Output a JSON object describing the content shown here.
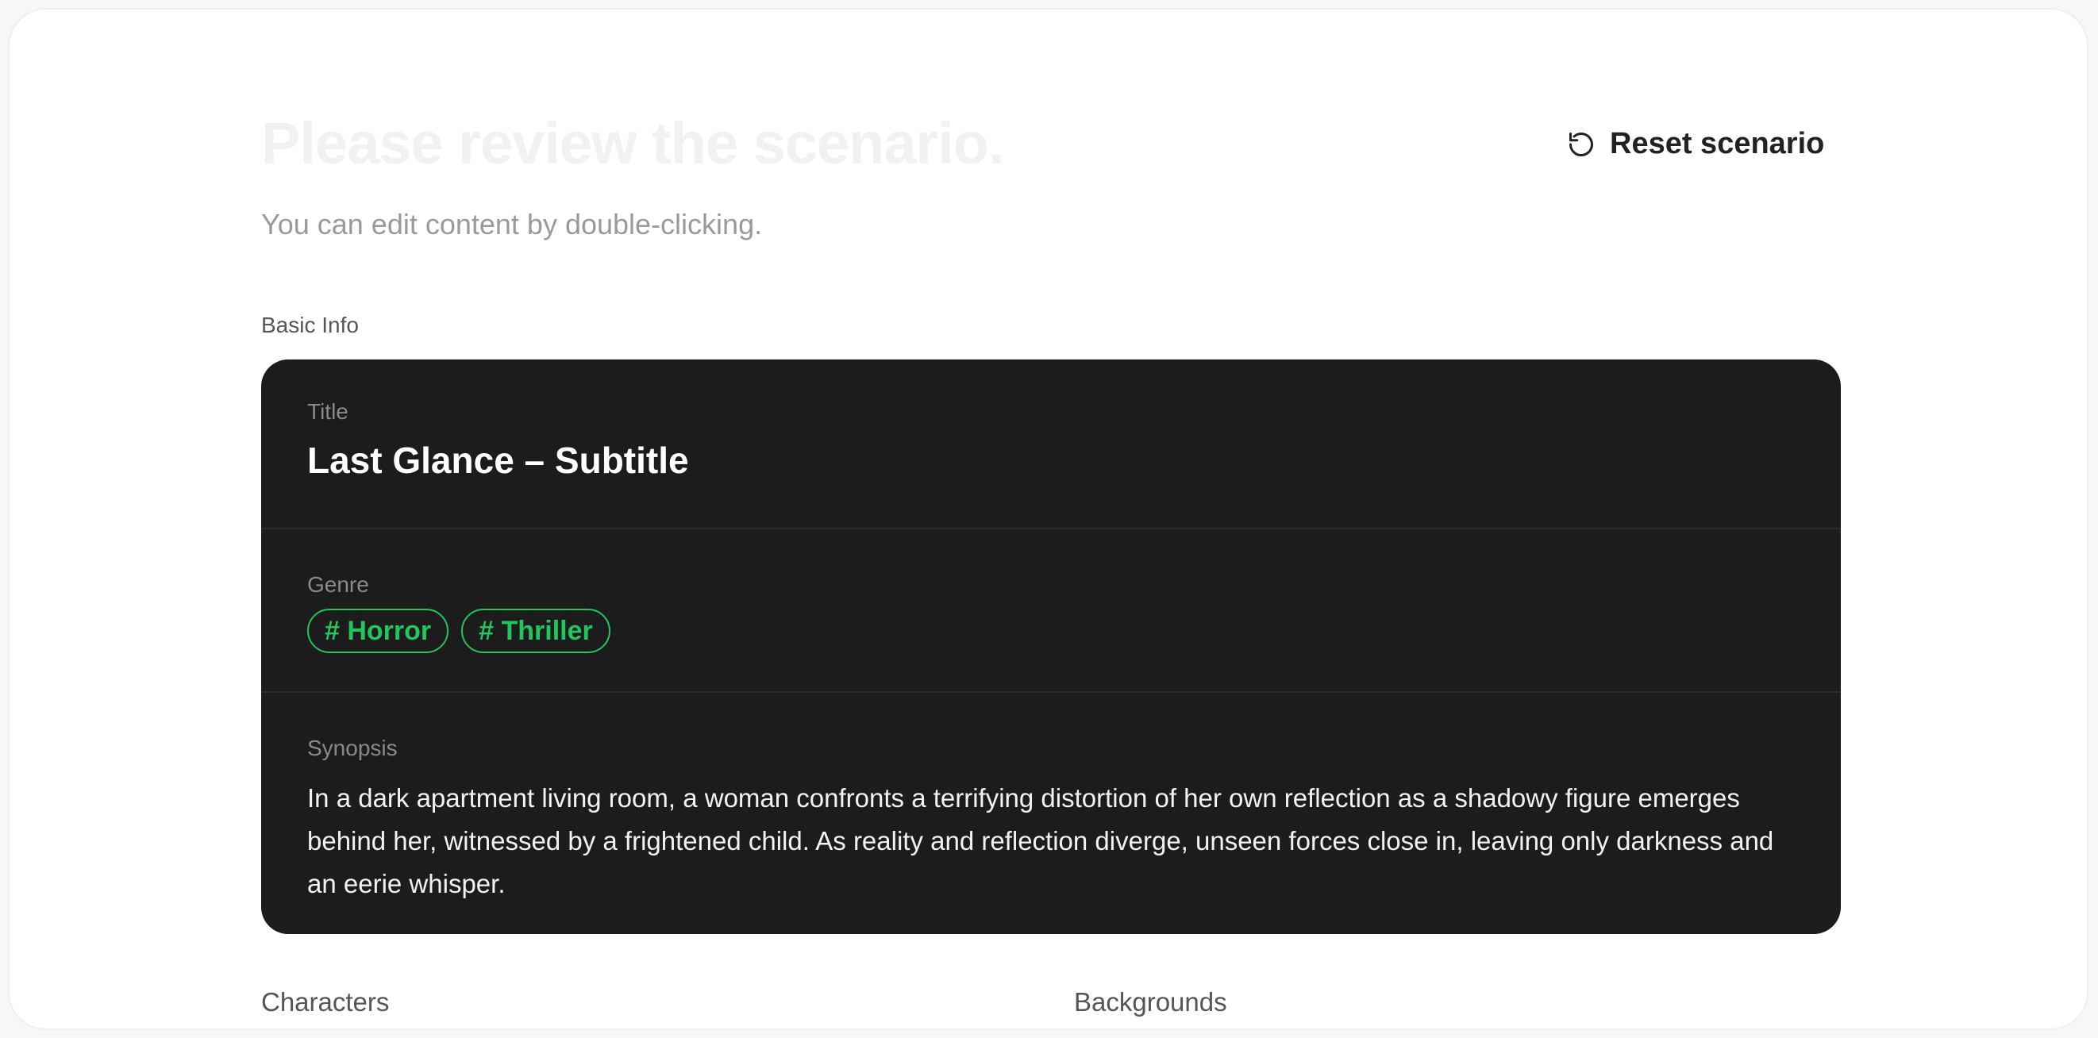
{
  "header": {
    "title": "Please review the scenario.",
    "subtitle": "You can edit content by double-clicking.",
    "reset_label": "Reset scenario",
    "reset_icon": "reset-icon"
  },
  "basic_info": {
    "section_label": "Basic Info",
    "title_label": "Title",
    "title_value": "Last Glance – Subtitle",
    "genre_label": "Genre",
    "genres": [
      "# Horror",
      "# Thriller"
    ],
    "synopsis_label": "Synopsis",
    "synopsis": "In a dark apartment living room, a woman confronts a terrifying distortion of her own reflection as a shadowy figure emerges behind her, witnessed by a frightened child. As reality and reflection diverge, unseen forces close in, leaving only darkness and an eerie whisper."
  },
  "sections": {
    "characters_label": "Characters",
    "backgrounds_label": "Backgrounds"
  },
  "colors": {
    "card_background": "#1c1c1c",
    "tag_accent": "#22c55e",
    "title_faded": "#f1f1f1"
  }
}
